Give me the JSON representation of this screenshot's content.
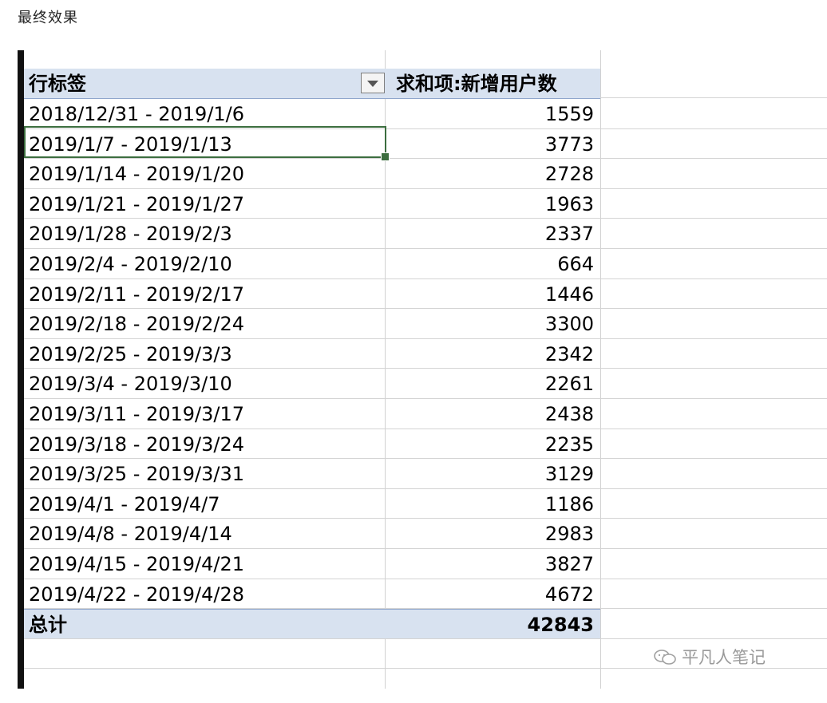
{
  "caption": "最终效果",
  "pivot": {
    "header": {
      "row_label": "行标签",
      "value_label": "求和项:新增用户数"
    },
    "rows": [
      {
        "label": "2018/12/31 - 2019/1/6",
        "value": "1559"
      },
      {
        "label": "2019/1/7 - 2019/1/13",
        "value": "3773"
      },
      {
        "label": "2019/1/14 - 2019/1/20",
        "value": "2728"
      },
      {
        "label": "2019/1/21 - 2019/1/27",
        "value": "1963"
      },
      {
        "label": "2019/1/28 - 2019/2/3",
        "value": "2337"
      },
      {
        "label": "2019/2/4 - 2019/2/10",
        "value": "664"
      },
      {
        "label": "2019/2/11 - 2019/2/17",
        "value": "1446"
      },
      {
        "label": "2019/2/18 - 2019/2/24",
        "value": "3300"
      },
      {
        "label": "2019/2/25 - 2019/3/3",
        "value": "2342"
      },
      {
        "label": "2019/3/4 - 2019/3/10",
        "value": "2261"
      },
      {
        "label": "2019/3/11 - 2019/3/17",
        "value": "2438"
      },
      {
        "label": "2019/3/18 - 2019/3/24",
        "value": "2235"
      },
      {
        "label": "2019/3/25 - 2019/3/31",
        "value": "3129"
      },
      {
        "label": "2019/4/1 - 2019/4/7",
        "value": "1186"
      },
      {
        "label": "2019/4/8 - 2019/4/14",
        "value": "2983"
      },
      {
        "label": "2019/4/15 - 2019/4/21",
        "value": "3827"
      },
      {
        "label": "2019/4/22 - 2019/4/28",
        "value": "4672"
      }
    ],
    "total": {
      "label": "总计",
      "value": "42843"
    }
  },
  "watermark": {
    "text": "平凡人笔记",
    "icon": "wechat-icon"
  },
  "colors": {
    "header_bg": "#d8e2f0",
    "selection_border": "#3c6e3f"
  }
}
